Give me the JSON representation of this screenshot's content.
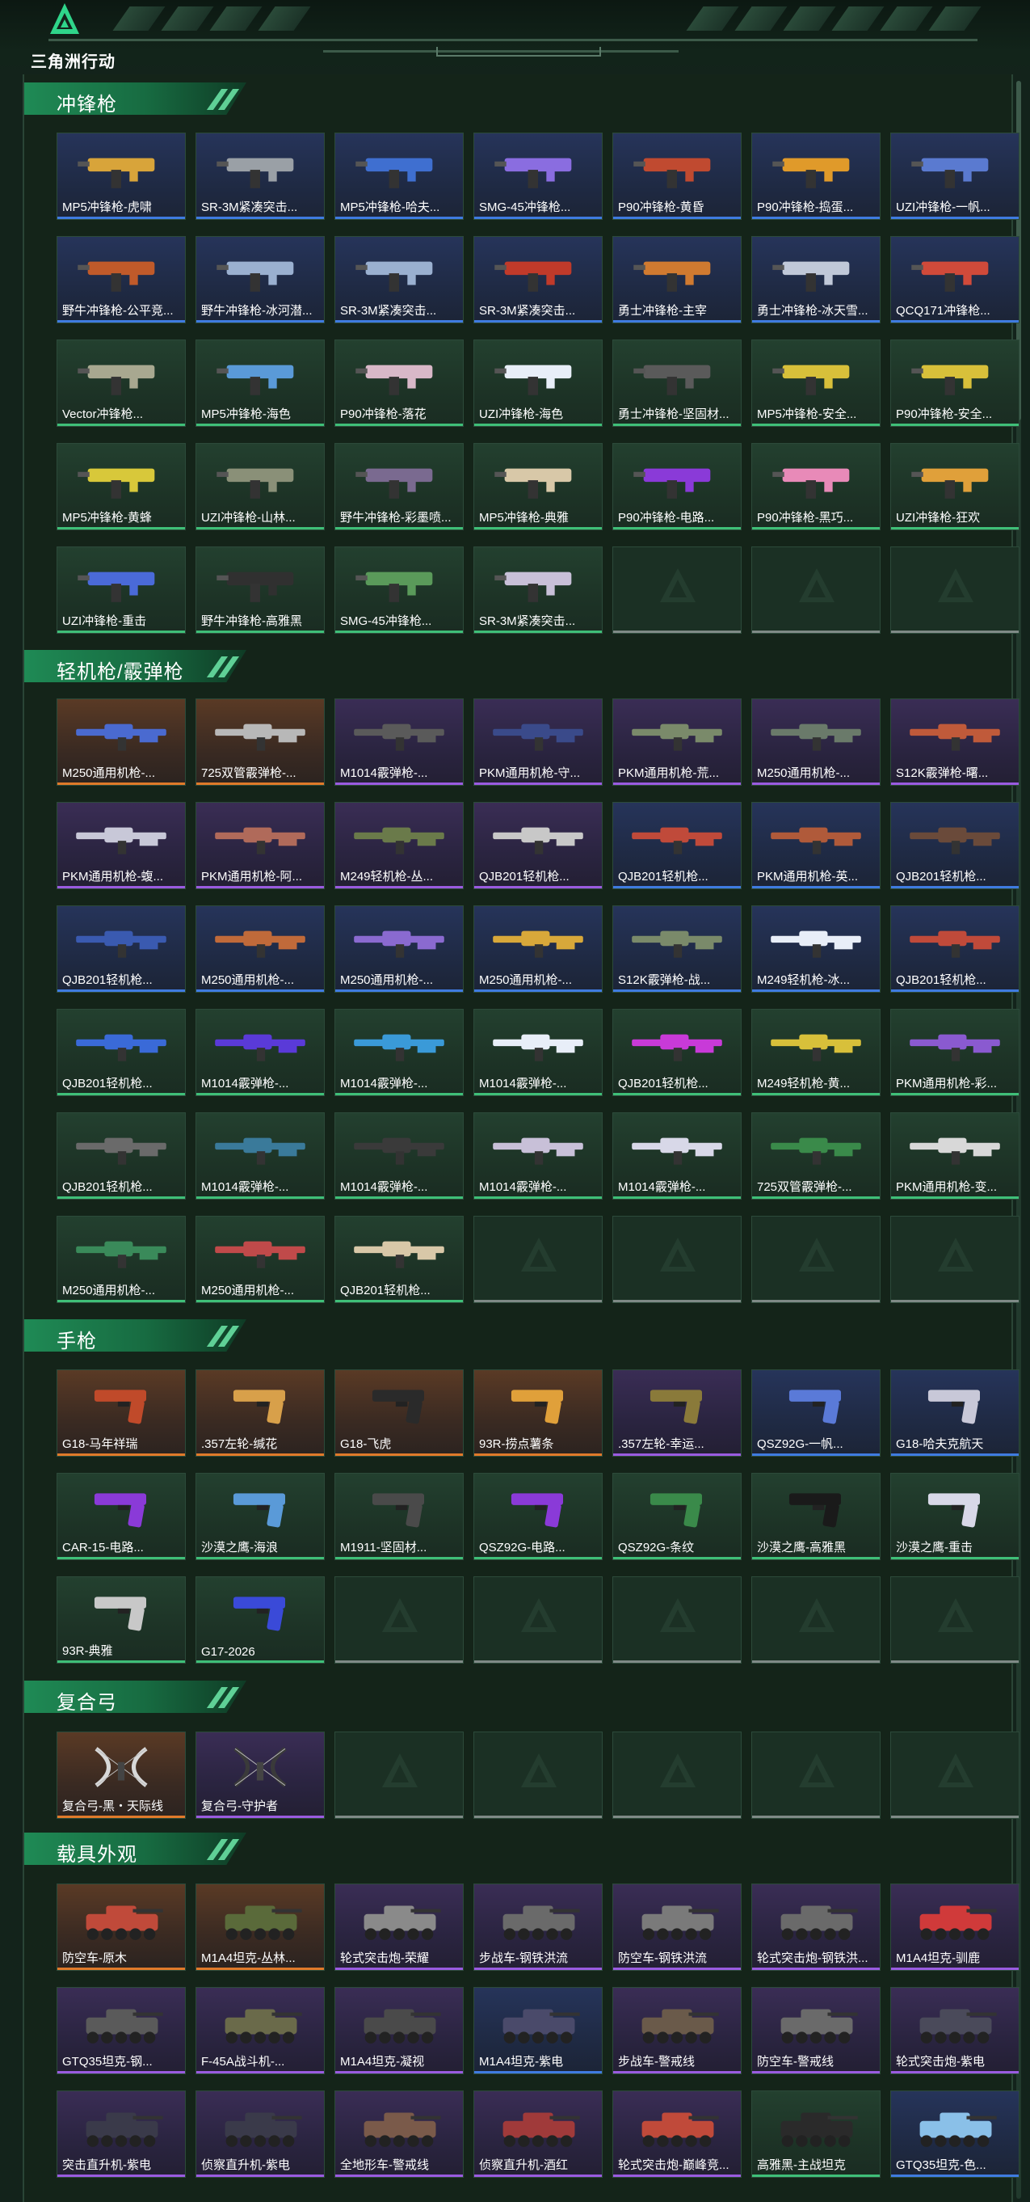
{
  "brand": {
    "name": "三角洲行动",
    "logo_icon": "delta-triangle-logo"
  },
  "colors": {
    "gold": "#e07a2a",
    "purple": "#9a5be0",
    "blue": "#3f7be0",
    "green": "#3fbf78",
    "header": "#1f8a55"
  },
  "sections": [
    {
      "title": "冲锋枪",
      "items": [
        {
          "label": "MP5冲锋枪-虎啸",
          "quality": "blue",
          "icon": "smg-icon",
          "color": "#d8a43a"
        },
        {
          "label": "SR-3M紧凑突击...",
          "quality": "blue",
          "icon": "smg-icon",
          "color": "#9aa0a6"
        },
        {
          "label": "MP5冲锋枪-哈夫...",
          "quality": "blue",
          "icon": "smg-icon",
          "color": "#3f6fd0"
        },
        {
          "label": "SMG-45冲锋枪...",
          "quality": "blue",
          "icon": "smg-icon",
          "color": "#8a6de0"
        },
        {
          "label": "P90冲锋枪-黄昏",
          "quality": "blue",
          "icon": "smg-icon",
          "color": "#c04a30"
        },
        {
          "label": "P90冲锋枪-捣蛋...",
          "quality": "blue",
          "icon": "smg-icon",
          "color": "#e09a2a"
        },
        {
          "label": "UZI冲锋枪-一帆...",
          "quality": "blue",
          "icon": "smg-icon",
          "color": "#5a7ad0"
        },
        {
          "label": "野牛冲锋枪-公平竞...",
          "quality": "blue",
          "icon": "smg-icon",
          "color": "#c05a2a"
        },
        {
          "label": "野牛冲锋枪-冰河潜...",
          "quality": "blue",
          "icon": "smg-icon",
          "color": "#9ab0d0"
        },
        {
          "label": "SR-3M紧凑突击...",
          "quality": "blue",
          "icon": "smg-icon",
          "color": "#9ab0d0"
        },
        {
          "label": "SR-3M紧凑突击...",
          "quality": "blue",
          "icon": "smg-icon",
          "color": "#c03a2a"
        },
        {
          "label": "勇士冲锋枪-主宰",
          "quality": "blue",
          "icon": "smg-icon",
          "color": "#d07a30"
        },
        {
          "label": "勇士冲锋枪-冰天雪...",
          "quality": "blue",
          "icon": "smg-icon",
          "color": "#c0c8d8"
        },
        {
          "label": "QCQ171冲锋枪...",
          "quality": "blue",
          "icon": "smg-icon",
          "color": "#d04a3a"
        },
        {
          "label": "Vector冲锋枪...",
          "quality": "green",
          "icon": "smg-icon",
          "color": "#a8a890"
        },
        {
          "label": "MP5冲锋枪-海色",
          "quality": "green",
          "icon": "smg-icon",
          "color": "#5a9ad8"
        },
        {
          "label": "P90冲锋枪-落花",
          "quality": "green",
          "icon": "smg-icon",
          "color": "#d8b8c8"
        },
        {
          "label": "UZI冲锋枪-海色",
          "quality": "green",
          "icon": "smg-icon",
          "color": "#e8eef8"
        },
        {
          "label": "勇士冲锋枪-坚固材...",
          "quality": "green",
          "icon": "smg-icon",
          "color": "#5a5a5a"
        },
        {
          "label": "MP5冲锋枪-安全...",
          "quality": "green",
          "icon": "smg-icon",
          "color": "#d8c03a"
        },
        {
          "label": "P90冲锋枪-安全...",
          "quality": "green",
          "icon": "smg-icon",
          "color": "#d8c03a"
        },
        {
          "label": "MP5冲锋枪-黄蜂",
          "quality": "green",
          "icon": "smg-icon",
          "color": "#d8c83a"
        },
        {
          "label": "UZI冲锋枪-山林...",
          "quality": "green",
          "icon": "smg-icon",
          "color": "#8a9078"
        },
        {
          "label": "野牛冲锋枪-彩墨喷...",
          "quality": "green",
          "icon": "smg-icon",
          "color": "#7a6a90"
        },
        {
          "label": "MP5冲锋枪-典雅",
          "quality": "green",
          "icon": "smg-icon",
          "color": "#d8c8a8"
        },
        {
          "label": "P90冲锋枪-电路...",
          "quality": "green",
          "icon": "smg-icon",
          "color": "#8a3ad8"
        },
        {
          "label": "P90冲锋枪-黑巧...",
          "quality": "green",
          "icon": "smg-icon",
          "color": "#e88ab8"
        },
        {
          "label": "UZI冲锋枪-狂欢",
          "quality": "green",
          "icon": "smg-icon",
          "color": "#e0a03a"
        },
        {
          "label": "UZI冲锋枪-重击",
          "quality": "green",
          "icon": "smg-icon",
          "color": "#4a6ad8"
        },
        {
          "label": "野牛冲锋枪-高雅黑",
          "quality": "green",
          "icon": "smg-icon",
          "color": "#303030"
        },
        {
          "label": "SMG-45冲锋枪...",
          "quality": "green",
          "icon": "smg-icon",
          "color": "#5a9a5a"
        },
        {
          "label": "SR-3M紧凑突击...",
          "quality": "green",
          "icon": "smg-icon",
          "color": "#c8c0d8"
        },
        {
          "label": "",
          "quality": "empty"
        },
        {
          "label": "",
          "quality": "empty"
        },
        {
          "label": "",
          "quality": "empty"
        }
      ]
    },
    {
      "title": "轻机枪/霰弹枪",
      "items": [
        {
          "label": "M250通用机枪-...",
          "quality": "gold",
          "icon": "rifle-icon",
          "color": "#4a6ad0"
        },
        {
          "label": "725双管霰弹枪-...",
          "quality": "gold",
          "icon": "rifle-icon",
          "color": "#b8b8b8"
        },
        {
          "label": "M1014霰弹枪-...",
          "quality": "purple",
          "icon": "rifle-icon",
          "color": "#5a5a5a"
        },
        {
          "label": "PKM通用机枪-守...",
          "quality": "purple",
          "icon": "rifle-icon",
          "color": "#3a4a8a"
        },
        {
          "label": "PKM通用机枪-荒...",
          "quality": "purple",
          "icon": "rifle-icon",
          "color": "#7a8a6a"
        },
        {
          "label": "M250通用机枪-...",
          "quality": "purple",
          "icon": "rifle-icon",
          "color": "#6a7a6a"
        },
        {
          "label": "S12K霰弹枪-曙...",
          "quality": "purple",
          "icon": "rifle-icon",
          "color": "#c05a3a"
        },
        {
          "label": "PKM通用机枪-蝮...",
          "quality": "purple",
          "icon": "rifle-icon",
          "color": "#c8c8d8"
        },
        {
          "label": "PKM通用机枪-阿...",
          "quality": "purple",
          "icon": "rifle-icon",
          "color": "#b06a5a"
        },
        {
          "label": "M249轻机枪-丛...",
          "quality": "purple",
          "icon": "rifle-icon",
          "color": "#6a7a4a"
        },
        {
          "label": "QJB201轻机枪...",
          "quality": "purple",
          "icon": "rifle-icon",
          "color": "#c8c8c8"
        },
        {
          "label": "QJB201轻机枪...",
          "quality": "blue",
          "icon": "rifle-icon",
          "color": "#c04a3a"
        },
        {
          "label": "PKM通用机枪-英...",
          "quality": "blue",
          "icon": "rifle-icon",
          "color": "#b05a3a"
        },
        {
          "label": "QJB201轻机枪...",
          "quality": "blue",
          "icon": "rifle-icon",
          "color": "#6a4a3a"
        },
        {
          "label": "QJB201轻机枪...",
          "quality": "blue",
          "icon": "rifle-icon",
          "color": "#3a5ab0"
        },
        {
          "label": "M250通用机枪-...",
          "quality": "blue",
          "icon": "rifle-icon",
          "color": "#c06a3a"
        },
        {
          "label": "M250通用机枪-...",
          "quality": "blue",
          "icon": "rifle-icon",
          "color": "#8a6ad0"
        },
        {
          "label": "M250通用机枪-...",
          "quality": "blue",
          "icon": "rifle-icon",
          "color": "#d8a83a"
        },
        {
          "label": "S12K霰弹枪-战...",
          "quality": "blue",
          "icon": "rifle-icon",
          "color": "#7a8a6a"
        },
        {
          "label": "M249轻机枪-冰...",
          "quality": "blue",
          "icon": "rifle-icon",
          "color": "#e8eef8"
        },
        {
          "label": "QJB201轻机枪...",
          "quality": "blue",
          "icon": "rifle-icon",
          "color": "#c04a3a"
        },
        {
          "label": "QJB201轻机枪...",
          "quality": "green",
          "icon": "rifle-icon",
          "color": "#3a6ad8"
        },
        {
          "label": "M1014霰弹枪-...",
          "quality": "green",
          "icon": "rifle-icon",
          "color": "#5a3ad8"
        },
        {
          "label": "M1014霰弹枪-...",
          "quality": "green",
          "icon": "rifle-icon",
          "color": "#3a9ad8"
        },
        {
          "label": "M1014霰弹枪-...",
          "quality": "green",
          "icon": "rifle-icon",
          "color": "#e8eef8"
        },
        {
          "label": "QJB201轻机枪...",
          "quality": "green",
          "icon": "rifle-icon",
          "color": "#c83ad8"
        },
        {
          "label": "M249轻机枪-黄...",
          "quality": "green",
          "icon": "rifle-icon",
          "color": "#d8c03a"
        },
        {
          "label": "PKM通用机枪-彩...",
          "quality": "green",
          "icon": "rifle-icon",
          "color": "#8a5ad0"
        },
        {
          "label": "QJB201轻机枪...",
          "quality": "green",
          "icon": "rifle-icon",
          "color": "#6a6a6a"
        },
        {
          "label": "M1014霰弹枪-...",
          "quality": "green",
          "icon": "rifle-icon",
          "color": "#3a7a9a"
        },
        {
          "label": "M1014霰弹枪-...",
          "quality": "green",
          "icon": "rifle-icon",
          "color": "#3a3a3a"
        },
        {
          "label": "M1014霰弹枪-...",
          "quality": "green",
          "icon": "rifle-icon",
          "color": "#c8c0d8"
        },
        {
          "label": "M1014霰弹枪-...",
          "quality": "green",
          "icon": "rifle-icon",
          "color": "#d8d8e8"
        },
        {
          "label": "725双管霰弹枪-...",
          "quality": "green",
          "icon": "rifle-icon",
          "color": "#3a8a4a"
        },
        {
          "label": "PKM通用机枪-变...",
          "quality": "green",
          "icon": "rifle-icon",
          "color": "#d8d8d8"
        },
        {
          "label": "M250通用机枪-...",
          "quality": "green",
          "icon": "rifle-icon",
          "color": "#3a8a5a"
        },
        {
          "label": "M250通用机枪-...",
          "quality": "green",
          "icon": "rifle-icon",
          "color": "#c04a4a"
        },
        {
          "label": "QJB201轻机枪...",
          "quality": "green",
          "icon": "rifle-icon",
          "color": "#d8c8a8"
        },
        {
          "label": "",
          "quality": "empty"
        },
        {
          "label": "",
          "quality": "empty"
        },
        {
          "label": "",
          "quality": "empty"
        },
        {
          "label": "",
          "quality": "empty"
        }
      ]
    },
    {
      "title": "手枪",
      "items": [
        {
          "label": "G18-马年祥瑞",
          "quality": "gold",
          "icon": "pistol-icon",
          "color": "#c04a2a"
        },
        {
          "label": ".357左轮-缄花",
          "quality": "gold",
          "icon": "pistol-icon",
          "color": "#d8a04a"
        },
        {
          "label": "G18-飞虎",
          "quality": "gold",
          "icon": "pistol-icon",
          "color": "#2a2a2a"
        },
        {
          "label": "93R-捞点薯条",
          "quality": "gold",
          "icon": "pistol-icon",
          "color": "#e0a03a"
        },
        {
          "label": ".357左轮-幸运...",
          "quality": "purple",
          "icon": "pistol-icon",
          "color": "#8a7a3a"
        },
        {
          "label": "QSZ92G-一帆...",
          "quality": "blue",
          "icon": "pistol-icon",
          "color": "#5a7ad8"
        },
        {
          "label": "G18-哈夫克航天",
          "quality": "blue",
          "icon": "pistol-icon",
          "color": "#c8c8d8"
        },
        {
          "label": "CAR-15-电路...",
          "quality": "green",
          "icon": "pistol-icon",
          "color": "#8a3ad8"
        },
        {
          "label": "沙漠之鹰-海浪",
          "quality": "green",
          "icon": "pistol-icon",
          "color": "#5a9ad8"
        },
        {
          "label": "M1911-坚固材...",
          "quality": "green",
          "icon": "pistol-icon",
          "color": "#4a4a4a"
        },
        {
          "label": "QSZ92G-电路...",
          "quality": "green",
          "icon": "pistol-icon",
          "color": "#8a3ad8"
        },
        {
          "label": "QSZ92G-条纹",
          "quality": "green",
          "icon": "pistol-icon",
          "color": "#3a8a4a"
        },
        {
          "label": "沙漠之鹰-高雅黑",
          "quality": "green",
          "icon": "pistol-icon",
          "color": "#1a1a1a"
        },
        {
          "label": "沙漠之鹰-重击",
          "quality": "green",
          "icon": "pistol-icon",
          "color": "#d8d8e8"
        },
        {
          "label": "93R-典雅",
          "quality": "green",
          "icon": "pistol-icon",
          "color": "#c8c8c8"
        },
        {
          "label": "G17-2026",
          "quality": "green",
          "icon": "pistol-icon",
          "color": "#3a4ad8"
        },
        {
          "label": "",
          "quality": "empty"
        },
        {
          "label": "",
          "quality": "empty"
        },
        {
          "label": "",
          "quality": "empty"
        },
        {
          "label": "",
          "quality": "empty"
        },
        {
          "label": "",
          "quality": "empty"
        }
      ]
    },
    {
      "title": "复合弓",
      "items": [
        {
          "label": "复合弓-黑・天际线",
          "quality": "gold",
          "icon": "bow-icon",
          "color": "#d8d8d8"
        },
        {
          "label": "复合弓-守护者",
          "quality": "purple",
          "icon": "bow-icon",
          "color": "#3a3a3a"
        },
        {
          "label": "",
          "quality": "empty"
        },
        {
          "label": "",
          "quality": "empty"
        },
        {
          "label": "",
          "quality": "empty"
        },
        {
          "label": "",
          "quality": "empty"
        },
        {
          "label": "",
          "quality": "empty"
        }
      ]
    },
    {
      "title": "载具外观",
      "items": [
        {
          "label": "防空车-原木",
          "quality": "gold",
          "icon": "vehicle-icon",
          "color": "#c04a3a"
        },
        {
          "label": "M1A4坦克-丛林...",
          "quality": "gold",
          "icon": "vehicle-icon",
          "color": "#5a6a3a"
        },
        {
          "label": "轮式突击炮-荣耀",
          "quality": "purple",
          "icon": "vehicle-icon",
          "color": "#8a8a8a"
        },
        {
          "label": "步战车-钢铁洪流",
          "quality": "purple",
          "icon": "vehicle-icon",
          "color": "#6a6a6a"
        },
        {
          "label": "防空车-钢铁洪流",
          "quality": "purple",
          "icon": "vehicle-icon",
          "color": "#7a7a7a"
        },
        {
          "label": "轮式突击炮-钢铁洪...",
          "quality": "purple",
          "icon": "vehicle-icon",
          "color": "#6a6a6a"
        },
        {
          "label": "M1A4坦克-驯鹿",
          "quality": "purple",
          "icon": "vehicle-icon",
          "color": "#d03a3a"
        },
        {
          "label": "GTQ35坦克-钢...",
          "quality": "purple",
          "icon": "vehicle-icon",
          "color": "#5a5a5a"
        },
        {
          "label": "F-45A战斗机-...",
          "quality": "purple",
          "icon": "vehicle-icon",
          "color": "#6a6a4a"
        },
        {
          "label": "M1A4坦克-凝视",
          "quality": "purple",
          "icon": "vehicle-icon",
          "color": "#4a4a4a"
        },
        {
          "label": "M1A4坦克-紫电",
          "quality": "blue",
          "icon": "vehicle-icon",
          "color": "#4a4a6a"
        },
        {
          "label": "步战车-警戒线",
          "quality": "purple",
          "icon": "vehicle-icon",
          "color": "#6a5a4a"
        },
        {
          "label": "防空车-警戒线",
          "quality": "purple",
          "icon": "vehicle-icon",
          "color": "#6a6a6a"
        },
        {
          "label": "轮式突击炮-紫电",
          "quality": "purple",
          "icon": "vehicle-icon",
          "color": "#4a4a5a"
        },
        {
          "label": "突击直升机-紫电",
          "quality": "purple",
          "icon": "vehicle-icon",
          "color": "#3a3a4a"
        },
        {
          "label": "侦察直升机-紫电",
          "quality": "purple",
          "icon": "vehicle-icon",
          "color": "#3a3a4a"
        },
        {
          "label": "全地形车-警戒线",
          "quality": "purple",
          "icon": "vehicle-icon",
          "color": "#7a5a4a"
        },
        {
          "label": "侦察直升机-酒红",
          "quality": "purple",
          "icon": "vehicle-icon",
          "color": "#a03a3a"
        },
        {
          "label": "轮式突击炮-巅峰竞...",
          "quality": "purple",
          "icon": "vehicle-icon",
          "color": "#c04a3a"
        },
        {
          "label": "高雅黑-主战坦克",
          "quality": "green",
          "icon": "vehicle-icon",
          "color": "#2a2a2a"
        },
        {
          "label": "GTQ35坦克-色...",
          "quality": "blue",
          "icon": "vehicle-icon",
          "color": "#8ac0e8"
        }
      ]
    }
  ]
}
